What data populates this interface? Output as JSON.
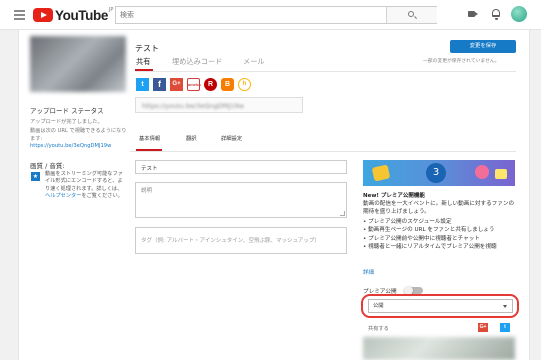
{
  "header": {
    "logo_word": "YouTube",
    "logo_sup": "JP",
    "search_placeholder": "検索"
  },
  "sidebar": {
    "upload_status_title": "アップロード ステータス",
    "upload_done": "アップロードが完了しました。",
    "url_label": "動画は次の URL で視聴できるようになります:",
    "video_url": "https://youtu.be/3eQngDMJ19w",
    "quality_title": "画質 / 音質:",
    "quality_icon": "★",
    "quality_text": "動画をストリーミング可能なファイル形式にエンコードすると、より速く処理されます。詳しくは、",
    "quality_link": "ヘルプセンター",
    "quality_text_end": "をご覧ください。"
  },
  "editor": {
    "video_title": "テスト",
    "save_button": "変更を保存",
    "save_note": "一部の変更が保存されていません。",
    "tabs": [
      "共有",
      "埋め込みコード",
      "メール"
    ],
    "social": [
      "t",
      "f",
      "G+",
      "ameba",
      "R",
      "B",
      "h"
    ],
    "share_url": "https://youtu.be/3eQngDMJ19w",
    "subtabs": [
      "基本情報",
      "翻訳",
      "詳細設定"
    ],
    "title_value": "テスト",
    "description_placeholder": "説明",
    "tags_placeholder": "タグ（例: アルバート・アインシュタイン、空飛ぶ豚、マッシュアップ）"
  },
  "premiere": {
    "banner_number": "3",
    "heading": "New! プレミア公開機能",
    "desc": "動画の配信を一大イベントに。新しい動画に対するファンの期待を盛り上げましょう。",
    "bullets": [
      "• プレミア公開のスケジュール設定",
      "• 動画再生ページの URL をファンと共有しましょう",
      "• プレミア公開前や公開中に視聴者とチャット",
      "• 視聴者と一緒にリアルタイムでプレミア公開を視聴"
    ],
    "more_link": "詳細",
    "public_label": "プレミア公開",
    "visibility_value": "公開",
    "share_to_label": "共有する",
    "share_gp": "G+",
    "share_tw": "t"
  },
  "colors": {
    "accent": "#167ac6",
    "tab_underline": "#cc181e",
    "highlight": "#e53935"
  }
}
